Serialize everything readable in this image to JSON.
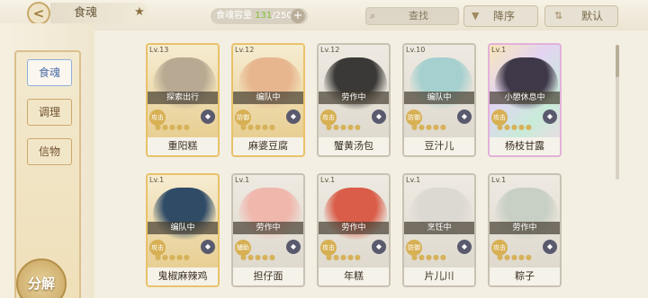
{
  "header": {
    "back_glyph": "<",
    "title": "食魂",
    "home_glyph": "★",
    "capacity_label": "食魂容量",
    "capacity_current": "131",
    "capacity_max": "/250",
    "capacity_plus": "+",
    "search_placeholder": "查找",
    "sort_label": "降序",
    "sort_glyph": "▼",
    "default_label": "默认",
    "default_glyph": "⇅"
  },
  "sidebar": {
    "tabs": [
      {
        "label": "食魂"
      },
      {
        "label": "调理"
      },
      {
        "label": "信物"
      }
    ],
    "split_label": "分解"
  },
  "cards": [
    {
      "level": "Lv.13",
      "status": "探索出行",
      "role": "攻击",
      "name": "重阳糕",
      "stars": "●●●●●",
      "portrait_color": "#b7a992",
      "frame": "gold"
    },
    {
      "level": "Lv.12",
      "status": "编队中",
      "role": "防御",
      "name": "麻婆豆腐",
      "stars": "●●●●●",
      "portrait_color": "#e7b68f",
      "frame": "gold"
    },
    {
      "level": "Lv.12",
      "status": "劳作中",
      "role": "攻击",
      "name": "蟹黄汤包",
      "stars": "●●●●●",
      "portrait_color": "#3b3937",
      "frame": "normal"
    },
    {
      "level": "Lv.10",
      "status": "编队中",
      "role": "防御",
      "name": "豆汁儿",
      "stars": "●●●●●",
      "portrait_color": "#a6d0cf",
      "frame": "normal"
    },
    {
      "level": "Lv.1",
      "status": "小憩休息中",
      "role": "攻击",
      "name": "杨枝甘露",
      "stars": "●●●●●",
      "portrait_color": "#3e3848",
      "frame": "rainbow"
    },
    {
      "level": "Lv.1",
      "status": "编队中",
      "role": "攻击",
      "name": "鬼椒麻辣鸡",
      "stars": "●●●●●",
      "portrait_color": "#2f4b66",
      "frame": "gold"
    },
    {
      "level": "Lv.1",
      "status": "劳作中",
      "role": "辅助",
      "name": "担仔面",
      "stars": "●●●●●",
      "portrait_color": "#f0b7ad",
      "frame": "normal"
    },
    {
      "level": "Lv.1",
      "status": "劳作中",
      "role": "攻击",
      "name": "年糕",
      "stars": "●●●●●",
      "portrait_color": "#d95d48",
      "frame": "normal"
    },
    {
      "level": "Lv.1",
      "status": "烹饪中",
      "role": "防御",
      "name": "片儿川",
      "stars": "●●●●●",
      "portrait_color": "#dcd8d2",
      "frame": "normal"
    },
    {
      "level": "Lv.1",
      "status": "劳作中",
      "role": "攻击",
      "name": "粽子",
      "stars": "●●●●●",
      "portrait_color": "#c8cfc4",
      "frame": "normal"
    }
  ]
}
